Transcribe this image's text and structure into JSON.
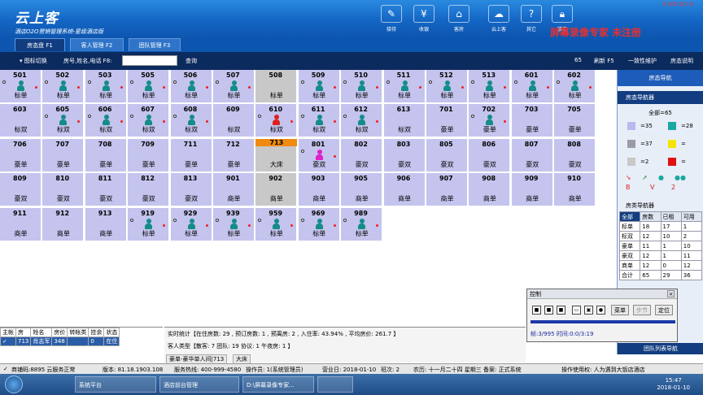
{
  "header": {
    "logo": "云上客",
    "subtitle": "酒店O2O营销管理系统-星级酒店版",
    "window_title": "0.0/0.3/1.0",
    "watermark": "屏幕录像专家 未注册",
    "toolbar": [
      {
        "label": "接待",
        "icon": "reception-icon"
      },
      {
        "label": "收银",
        "icon": "cashier-icon"
      },
      {
        "label": "客房",
        "icon": "room-icon"
      },
      {
        "label": "云上客",
        "icon": "cloud-icon"
      },
      {
        "label": "其它",
        "icon": "help-icon"
      },
      {
        "label": "锁定",
        "icon": "lock-icon"
      }
    ]
  },
  "tabs": [
    "房态盘 F1",
    "客人管理 F2",
    "团队管理 F3"
  ],
  "searchbar": {
    "icon_switch": "图标切换",
    "search_label": "房号,姓名,电话 F8:",
    "search_value": "",
    "query": "查询",
    "count": "65",
    "refresh": "刷新 F5",
    "maintain": "一致性维护",
    "legend": "房态说明"
  },
  "rooms": [
    {
      "num": "501",
      "type": "标单",
      "status": "vacant",
      "person": "teal"
    },
    {
      "num": "502",
      "type": "标单",
      "status": "vacant",
      "person": "teal"
    },
    {
      "num": "503",
      "type": "标单",
      "status": "vacant",
      "person": "teal"
    },
    {
      "num": "505",
      "type": "标单",
      "status": "vacant",
      "person": "teal"
    },
    {
      "num": "506",
      "type": "标单",
      "status": "vacant",
      "person": "teal"
    },
    {
      "num": "507",
      "type": "标单",
      "status": "vacant",
      "person": "teal"
    },
    {
      "num": "508",
      "type": "标单",
      "status": "dirty",
      "person": ""
    },
    {
      "num": "509",
      "type": "标单",
      "status": "vacant",
      "person": "teal"
    },
    {
      "num": "510",
      "type": "标单",
      "status": "vacant",
      "person": "teal"
    },
    {
      "num": "511",
      "type": "标单",
      "status": "vacant",
      "person": "teal"
    },
    {
      "num": "512",
      "type": "标单",
      "status": "vacant",
      "person": "teal"
    },
    {
      "num": "513",
      "type": "标单",
      "status": "vacant",
      "person": "teal"
    },
    {
      "num": "601",
      "type": "标单",
      "status": "vacant",
      "person": "teal"
    },
    {
      "num": "602",
      "type": "标单",
      "status": "vacant",
      "person": "teal"
    },
    {
      "num": "603",
      "type": "标双",
      "status": "vacant",
      "person": ""
    },
    {
      "num": "605",
      "type": "标双",
      "status": "vacant",
      "person": "teal"
    },
    {
      "num": "606",
      "type": "标双",
      "status": "vacant",
      "person": "teal"
    },
    {
      "num": "607",
      "type": "标双",
      "status": "vacant",
      "person": "teal"
    },
    {
      "num": "608",
      "type": "标双",
      "status": "vacant",
      "person": "teal"
    },
    {
      "num": "609",
      "type": "标双",
      "status": "vacant",
      "person": ""
    },
    {
      "num": "610",
      "type": "标双",
      "status": "vacant",
      "person": "red"
    },
    {
      "num": "611",
      "type": "标双",
      "status": "vacant",
      "person": "teal"
    },
    {
      "num": "612",
      "type": "标双",
      "status": "vacant",
      "person": "teal"
    },
    {
      "num": "613",
      "type": "标双",
      "status": "vacant",
      "person": ""
    },
    {
      "num": "701",
      "type": "豪单",
      "status": "vacant",
      "person": ""
    },
    {
      "num": "702",
      "type": "豪单",
      "status": "vacant",
      "person": "teal"
    },
    {
      "num": "703",
      "type": "豪单",
      "status": "vacant",
      "person": ""
    },
    {
      "num": "705",
      "type": "豪单",
      "status": "vacant",
      "person": ""
    },
    {
      "num": "706",
      "type": "豪单",
      "status": "vacant",
      "person": ""
    },
    {
      "num": "707",
      "type": "豪单",
      "status": "vacant",
      "person": ""
    },
    {
      "num": "708",
      "type": "豪单",
      "status": "vacant",
      "person": ""
    },
    {
      "num": "709",
      "type": "豪单",
      "status": "vacant",
      "person": ""
    },
    {
      "num": "711",
      "type": "豪单",
      "status": "vacant",
      "person": ""
    },
    {
      "num": "712",
      "type": "豪单",
      "status": "vacant",
      "person": ""
    },
    {
      "num": "713",
      "type": "大床",
      "status": "selected",
      "person": ""
    },
    {
      "num": "801",
      "type": "豪双",
      "status": "vacant",
      "person": "magenta"
    },
    {
      "num": "802",
      "type": "豪双",
      "status": "vacant",
      "person": ""
    },
    {
      "num": "803",
      "type": "豪双",
      "status": "vacant",
      "person": ""
    },
    {
      "num": "805",
      "type": "豪双",
      "status": "vacant",
      "person": ""
    },
    {
      "num": "806",
      "type": "豪双",
      "status": "vacant",
      "person": ""
    },
    {
      "num": "807",
      "type": "豪双",
      "status": "vacant",
      "person": ""
    },
    {
      "num": "808",
      "type": "豪双",
      "status": "vacant",
      "person": ""
    },
    {
      "num": "809",
      "type": "豪双",
      "status": "vacant",
      "person": ""
    },
    {
      "num": "810",
      "type": "豪双",
      "status": "vacant",
      "person": ""
    },
    {
      "num": "811",
      "type": "豪双",
      "status": "vacant",
      "person": ""
    },
    {
      "num": "812",
      "type": "豪双",
      "status": "vacant",
      "person": ""
    },
    {
      "num": "813",
      "type": "豪双",
      "status": "vacant",
      "person": ""
    },
    {
      "num": "901",
      "type": "商单",
      "status": "vacant",
      "person": ""
    },
    {
      "num": "902",
      "type": "商单",
      "status": "dirty",
      "person": ""
    },
    {
      "num": "903",
      "type": "商单",
      "status": "vacant",
      "person": ""
    },
    {
      "num": "905",
      "type": "商单",
      "status": "vacant",
      "person": ""
    },
    {
      "num": "906",
      "type": "商单",
      "status": "vacant",
      "person": ""
    },
    {
      "num": "907",
      "type": "商单",
      "status": "vacant",
      "person": ""
    },
    {
      "num": "908",
      "type": "商单",
      "status": "vacant",
      "person": ""
    },
    {
      "num": "909",
      "type": "商单",
      "status": "vacant",
      "person": ""
    },
    {
      "num": "910",
      "type": "商单",
      "status": "vacant",
      "person": ""
    },
    {
      "num": "911",
      "type": "商单",
      "status": "vacant",
      "person": ""
    },
    {
      "num": "912",
      "type": "商单",
      "status": "vacant",
      "person": ""
    },
    {
      "num": "913",
      "type": "商单",
      "status": "vacant",
      "person": ""
    },
    {
      "num": "919",
      "type": "标单",
      "status": "vacant",
      "person": "teal"
    },
    {
      "num": "929",
      "type": "标单",
      "status": "vacant",
      "person": "teal"
    },
    {
      "num": "939",
      "type": "标单",
      "status": "vacant",
      "person": "teal"
    },
    {
      "num": "959",
      "type": "标单",
      "status": "vacant",
      "person": "teal"
    },
    {
      "num": "969",
      "type": "标单",
      "status": "vacant",
      "person": "teal"
    },
    {
      "num": "989",
      "type": "标单",
      "status": "vacant",
      "person": "teal"
    }
  ],
  "right_nav": {
    "title": "房态导航",
    "sub_title": "房态导航器",
    "all": "全部=65",
    "legend": [
      {
        "color": "#b9b9f0",
        "text": "=35"
      },
      {
        "color": "#1aa8a0",
        "text": "=28"
      },
      {
        "color": "#9a9aa8",
        "text": "=37"
      },
      {
        "color": "#f4e400",
        "text": "="
      },
      {
        "color": "#c8c8c8",
        "text": "=2"
      },
      {
        "color": "#e01010",
        "text": "="
      }
    ],
    "legend_symbols": [
      "B",
      "V",
      "2"
    ],
    "nav2_title": "房类导航器",
    "table_headers": [
      "全部",
      "房数",
      "已租",
      "可用"
    ],
    "table_rows": [
      [
        "标单",
        "18",
        "17",
        "1"
      ],
      [
        "标双",
        "12",
        "10",
        "2"
      ],
      [
        "豪单",
        "11",
        "1",
        "10"
      ],
      [
        "豪双",
        "12",
        "1",
        "11"
      ],
      [
        "商单",
        "12",
        "0",
        "12"
      ],
      [
        "合计",
        "65",
        "29",
        "36"
      ]
    ],
    "footer": "团队列表导航"
  },
  "guest_panel": {
    "headers": [
      "主帐",
      "房",
      "姓名",
      "房价",
      "转帐类",
      "挂余",
      "状态"
    ],
    "row": [
      "✓",
      "713",
      "肖志军",
      "348",
      "",
      "0",
      "在住"
    ]
  },
  "stats": {
    "realtime": "实时统计【在住房数: 29 , 预订房数: 1 , 预离房: 2 , 入住率: 43.94% , 平均房价: 261.7 】",
    "guest_types": "客人类型【散客: 7 团队: 19 协议: 1 午夜房: 1 】",
    "sub_tabs": [
      "豪单-豪华单人间|713",
      "大床"
    ]
  },
  "control": {
    "title": "控制",
    "btn_dish": "菜单",
    "btn_step": "步节",
    "btn_locate": "定位",
    "frame_time": "帧:3/995 时间:0:0/3:19"
  },
  "statusbar": {
    "code": "商铺码:8895 云服务正常",
    "version": "版本: 81.18.1903.108",
    "hotline": "服务热线: 400-999-4580",
    "operator": "操作员: 1(系统管理员)",
    "business_date": "营业日: 2018-01-10",
    "shift": "班次: 2",
    "lunar": "农历: 十一月二十四 星期三 备案: 正式系统",
    "licensee": "操作使用权: 人为遇到大饭店酒店"
  },
  "taskbar": {
    "tasks": [
      "系统平台",
      "酒店前台管理",
      "D:\\屏幕录像专家...",
      ""
    ],
    "time": "15:47",
    "date": "2018-01-10"
  }
}
